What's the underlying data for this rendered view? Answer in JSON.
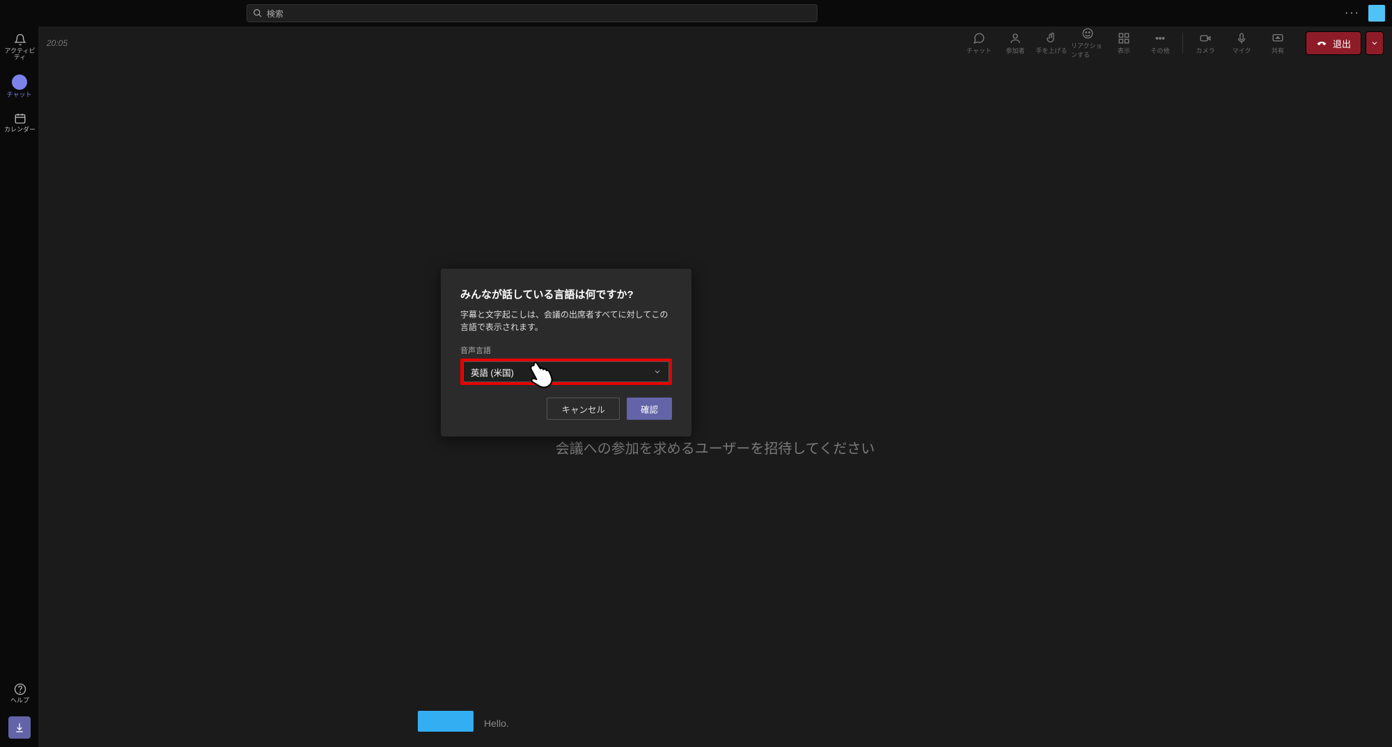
{
  "topbar": {
    "search_placeholder": "検索"
  },
  "left_rail": {
    "activity": "アクティビティ",
    "chat": "チャット",
    "calendar": "カレンダー",
    "help": "ヘルプ"
  },
  "meeting_bar": {
    "time": "20:05",
    "controls": {
      "chat": "チャット",
      "participants": "参加者",
      "raise_hand": "手を上げる",
      "react": "リアクションする",
      "view": "表示",
      "more": "その他",
      "camera": "カメラ",
      "mic": "マイク",
      "share": "共有"
    },
    "leave": "退出"
  },
  "stage": {
    "invite_prompt": "会議への参加を求めるユーザーを招待してください",
    "participant_caption": "Hello."
  },
  "dialog": {
    "title": "みんなが話している言語は何ですか?",
    "description": "字幕と文字起こしは、会議の出席者すべてに対してこの言語で表示されます。",
    "field_label": "音声言語",
    "selected_language": "英語 (米国)",
    "cancel": "キャンセル",
    "confirm": "確認"
  }
}
